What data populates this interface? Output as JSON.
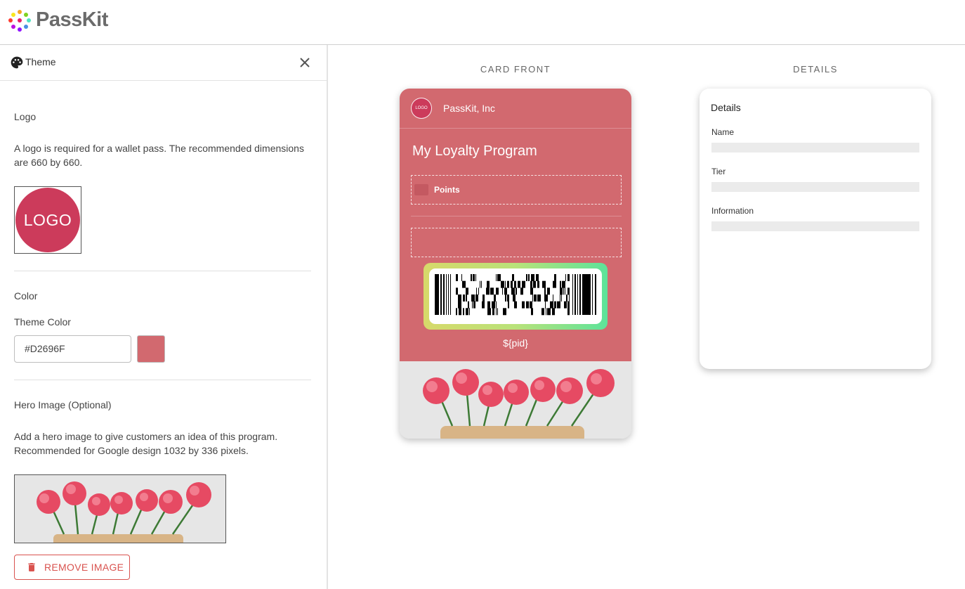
{
  "app": {
    "brand": "PassKit"
  },
  "panel": {
    "title": "Theme",
    "logo_section": {
      "label": "Logo",
      "description": "A logo is required for a wallet pass. The recommended dimensions are 660 by 660.",
      "logo_text": "LOGO"
    },
    "color_section": {
      "label": "Color",
      "field_label": "Theme Color",
      "value": "#D2696F",
      "swatch_color": "#D2696F"
    },
    "hero_section": {
      "label": "Hero Image (Optional)",
      "description": "Add a hero image to give customers an idea of this program. Recommended for Google design 1032 by 336 pixels.",
      "remove_label": "REMOVE IMAGE"
    }
  },
  "preview": {
    "front_title": "CARD FRONT",
    "details_title": "DETAILS",
    "card": {
      "logo_text": "LOGO",
      "issuer": "PassKit, Inc",
      "program": "My Loyalty Program",
      "field_label": "Points",
      "pid": "${pid}",
      "background": "#D2696F"
    },
    "details": {
      "heading": "Details",
      "fields": [
        "Name",
        "Tier",
        "Information"
      ]
    }
  },
  "icons": {
    "brand": "passkit-dots-icon",
    "panel": "palette-icon",
    "close": "close-icon",
    "remove": "trash-icon"
  }
}
